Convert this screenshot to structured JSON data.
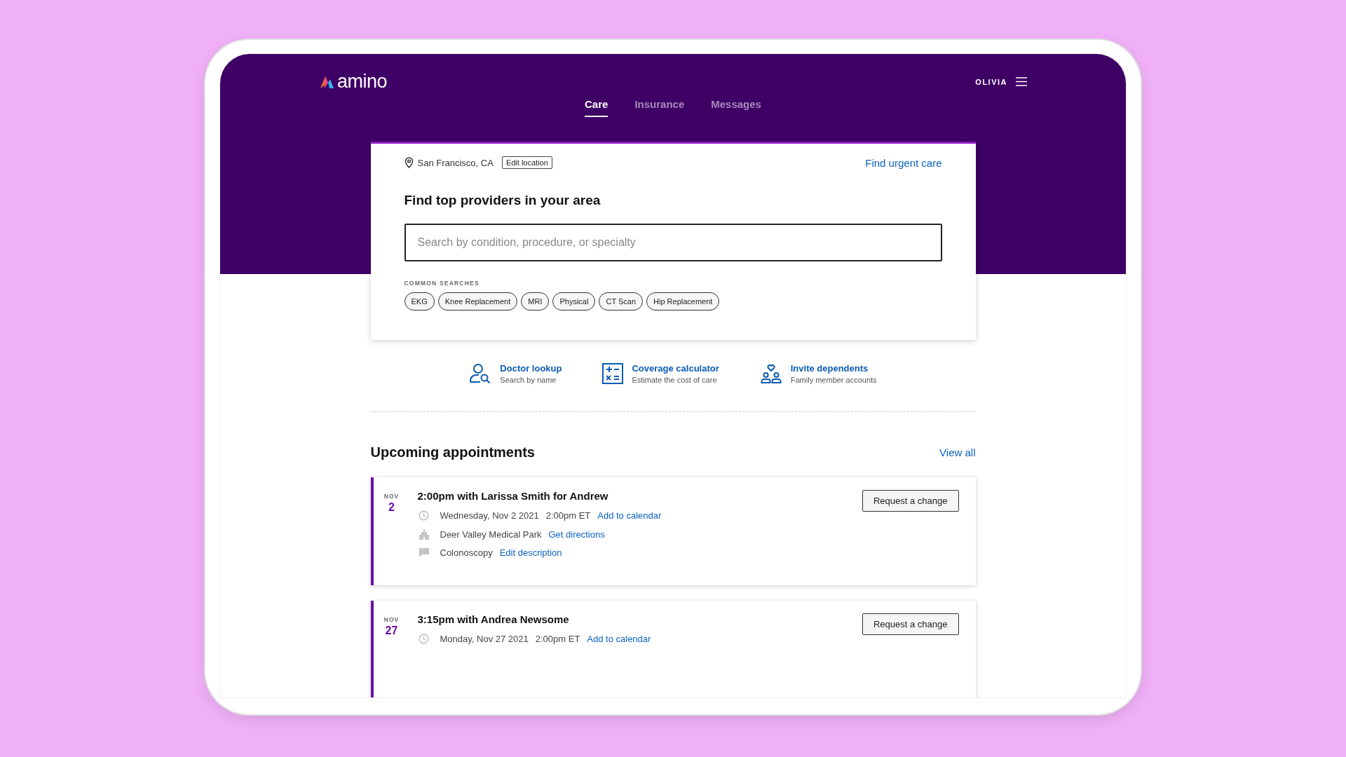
{
  "header": {
    "logo": "amino",
    "user": "OLIVIA"
  },
  "tabs": [
    {
      "label": "Care",
      "selected": true
    },
    {
      "label": "Insurance",
      "selected": false
    },
    {
      "label": "Messages",
      "selected": false
    }
  ],
  "search_card": {
    "location": "San Francisco, CA",
    "edit_button": "Edit location",
    "urgent_link": "Find urgent care",
    "heading": "Find top providers in your area",
    "search": {
      "placeholder": "Search by condition, procedure, or specialty"
    },
    "common_label": "COMMON SEARCHES",
    "chips": [
      "EKG",
      "Knee Replacement",
      "MRI",
      "Physical",
      "CT Scan",
      "Hip Replacement"
    ]
  },
  "quick_links": [
    {
      "kind": "doctor",
      "title": "Doctor lookup",
      "subtitle": "Search by name"
    },
    {
      "kind": "calculator",
      "title": "Coverage calculator",
      "subtitle": "Estimate the cost of care"
    },
    {
      "kind": "dependents",
      "title": "Invite dependents",
      "subtitle": "Family member accounts"
    }
  ],
  "appointments": {
    "heading": "Upcoming appointments",
    "view_all": "View all",
    "items": [
      {
        "month": "NOV",
        "day": "2",
        "title": "2:00pm with Larissa Smith for Andrew",
        "button": "Request a change",
        "details": [
          {
            "kind": "time",
            "text": "Wednesday, Nov 2 2021",
            "extra": "2:00pm ET",
            "link": "Add to calendar"
          },
          {
            "kind": "place",
            "text": "Deer Valley Medical Park",
            "link": "Get directions"
          },
          {
            "kind": "note",
            "text": "Colonoscopy",
            "link": "Edit description"
          }
        ]
      },
      {
        "month": "NOV",
        "day": "27",
        "title": "3:15pm with Andrea Newsome",
        "button": "Request a change",
        "details": [
          {
            "kind": "time",
            "text": "Monday, Nov 27 2021",
            "extra": "2:00pm ET",
            "link": "Add to calendar"
          }
        ]
      }
    ]
  }
}
